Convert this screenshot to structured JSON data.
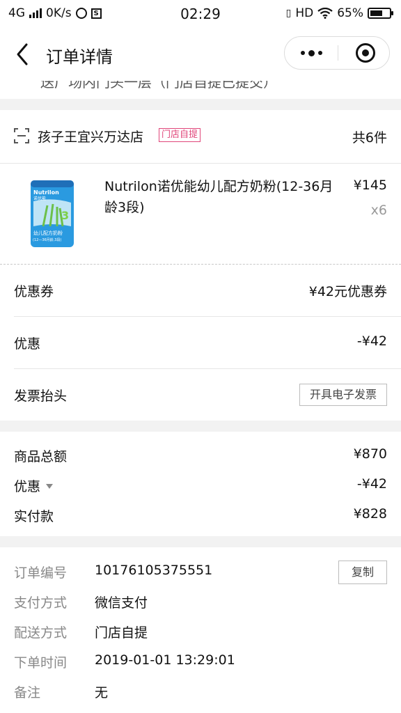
{
  "status_bar": {
    "network": "4G",
    "speed": "0K/s",
    "sq_icon_glyph": "S",
    "time": "02:29",
    "hd": "HD",
    "battery": "65%",
    "battery_level": 0.65
  },
  "nav": {
    "title": "订单详情"
  },
  "address_fragment": "送广场内门头一层（门店自提已提交）",
  "store": {
    "name": "孩子王宜兴万达店",
    "tag": "门店自提",
    "count": "共6件"
  },
  "product": {
    "name": " Nutrilon诺优能幼儿配方奶粉(12-36月龄3段)",
    "price": "¥145",
    "qty": "x6",
    "image_text": {
      "brand": "Nutrilon",
      "cn_brand": "诺优能",
      "stage": "3",
      "desc": "幼儿配方奶粉",
      "age": "(12—36月龄,3段)"
    }
  },
  "discounts": {
    "coupon_label": "优惠券",
    "coupon_value": "¥42元优惠券",
    "discount_label": "优惠",
    "discount_value": "-¥42",
    "invoice_label": "发票抬头",
    "invoice_button": "开具电子发票"
  },
  "summary": {
    "total_label": "商品总额",
    "total_value": "¥870",
    "discount_label": "优惠",
    "discount_value": "-¥42",
    "paid_label": "实付款",
    "paid_value": "¥828"
  },
  "order_info": {
    "id_label": "订单编号",
    "id_value": "10176105375551",
    "copy_button": "复制",
    "pay_label": "支付方式",
    "pay_value": "微信支付",
    "ship_label": "配送方式",
    "ship_value": "门店自提",
    "time_label": "下单时间",
    "time_value": "2019-01-01 13:29:01",
    "note_label": "备注",
    "note_value": "无"
  }
}
